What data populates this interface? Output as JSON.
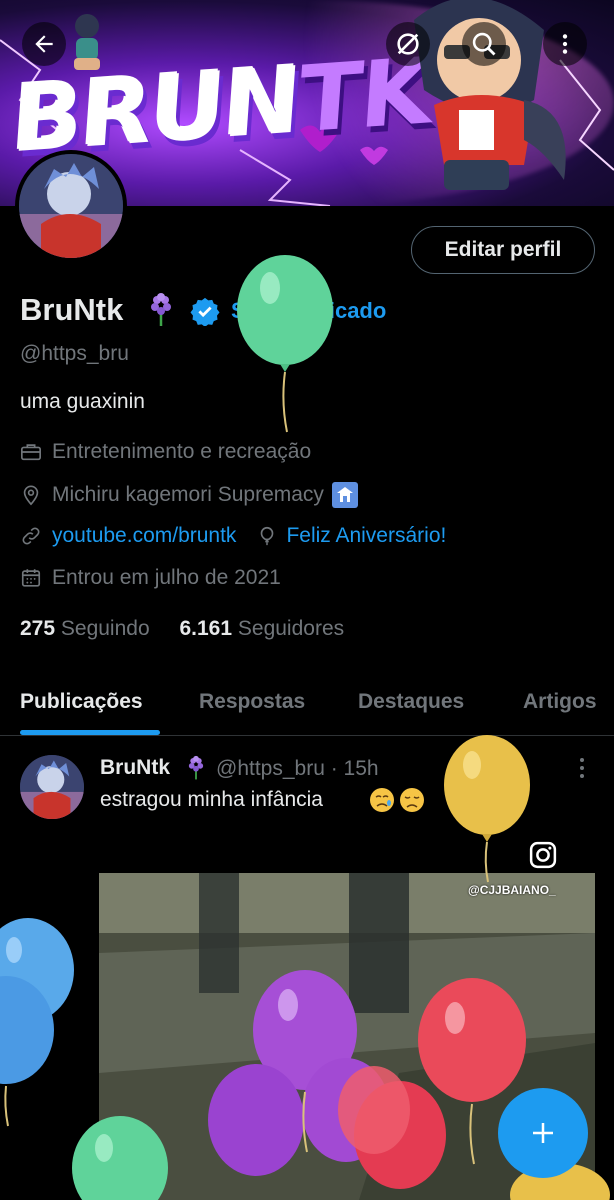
{
  "banner": {
    "title_main": "BRUN",
    "title_accent": "TK"
  },
  "header": {
    "back_icon": "arrow-left-icon",
    "no_sync_icon": "circle-slash-icon",
    "search_icon": "search-icon",
    "more_icon": "more-vertical-icon"
  },
  "profile": {
    "edit_label": "Editar perfil",
    "name": "BruNtk",
    "get_verified": "Seja verificado",
    "handle": "@https_bru",
    "bio": "uma guaxinin",
    "category": "Entretenimento e recreação",
    "location": "Michiru kagemori Supremacy",
    "website": "youtube.com/bruntk",
    "birthday": "Feliz Aniversário!",
    "joined": "Entrou em julho de 2021"
  },
  "stats": {
    "following_count": "275",
    "following_label": "Seguindo",
    "followers_count": "6.161",
    "followers_label": "Seguidores"
  },
  "tabs": [
    {
      "label": "Publicações"
    },
    {
      "label": "Respostas"
    },
    {
      "label": "Destaques"
    },
    {
      "label": "Artigos"
    }
  ],
  "post": {
    "author": "BruNtk",
    "handle_time": "@https_bru · 15h",
    "text": "estragou minha infância",
    "watermark": "@CJJBAIANO_"
  },
  "colors": {
    "accent": "#1d9bf0",
    "background": "#000000",
    "text": "#e7e9ea",
    "muted": "#71767b"
  }
}
